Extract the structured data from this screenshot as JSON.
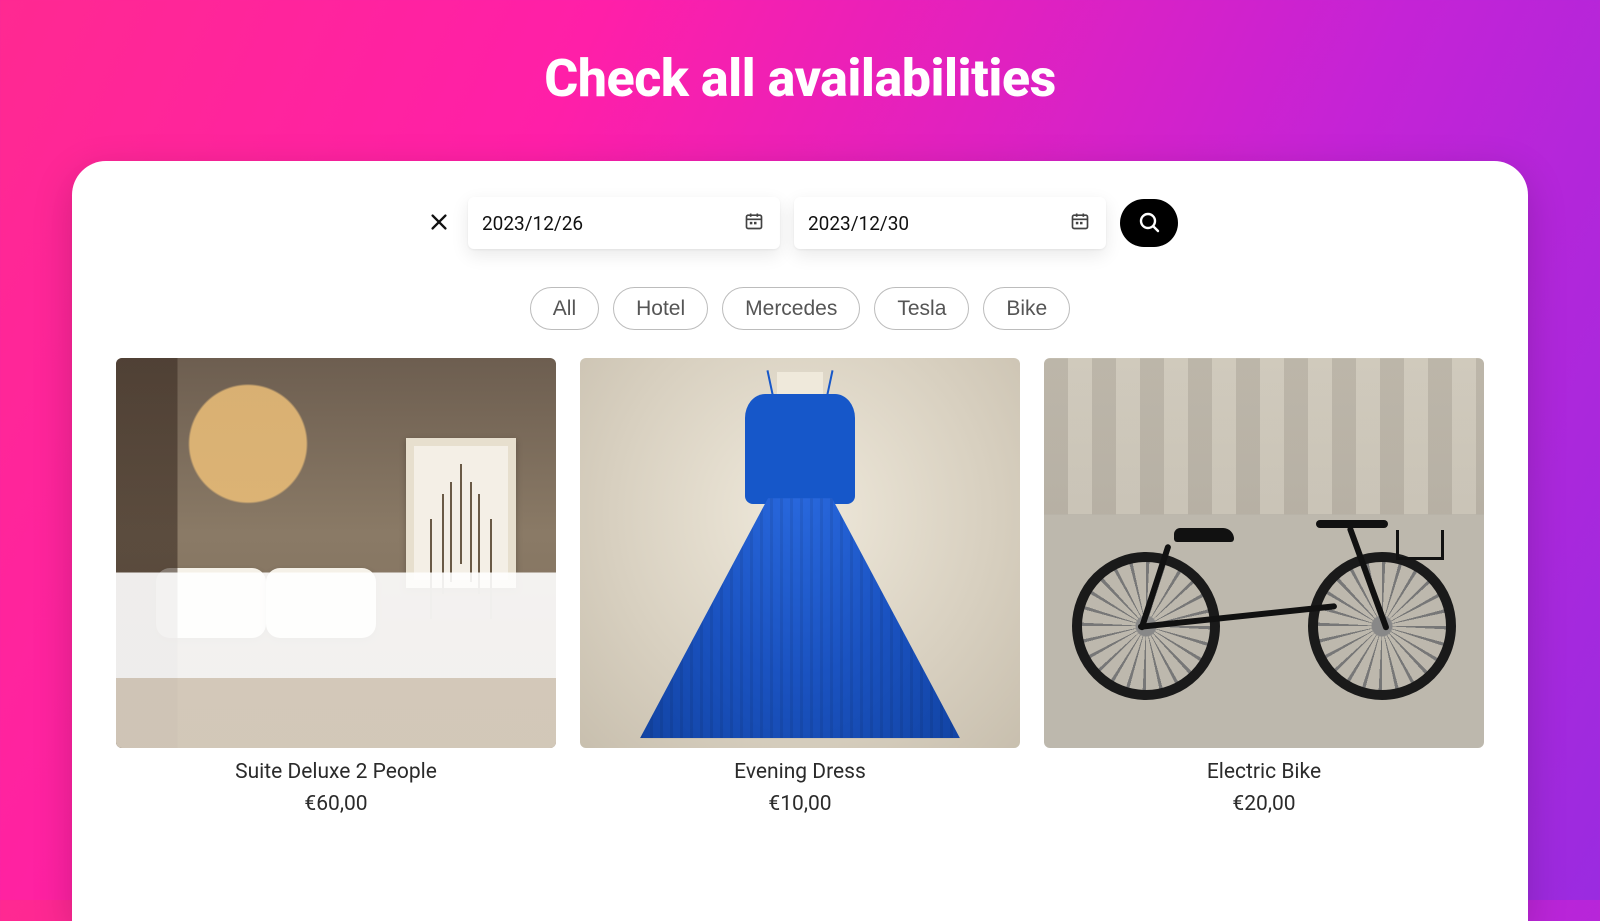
{
  "header": {
    "title": "Check all availabilities"
  },
  "search": {
    "start_date": "2023/12/26",
    "end_date": "2023/12/30"
  },
  "filters": [
    {
      "label": "All"
    },
    {
      "label": "Hotel"
    },
    {
      "label": "Mercedes"
    },
    {
      "label": "Tesla"
    },
    {
      "label": "Bike"
    }
  ],
  "products": [
    {
      "name": "Suite Deluxe 2 People",
      "price": "€60,00"
    },
    {
      "name": "Evening Dress",
      "price": "€10,00"
    },
    {
      "name": "Electric Bike",
      "price": "€20,00"
    }
  ]
}
